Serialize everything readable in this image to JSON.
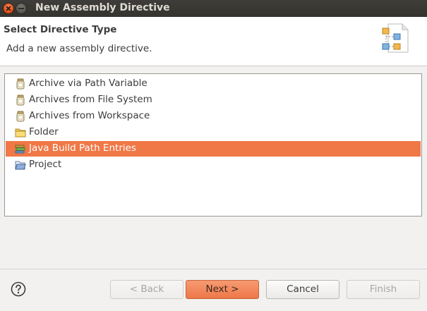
{
  "window": {
    "title": "New Assembly Directive"
  },
  "header": {
    "title": "Select Directive Type",
    "description": "Add a new assembly directive.",
    "icon": "wizard-banner-icon"
  },
  "list": {
    "items": [
      {
        "label": "Archive via Path Variable",
        "icon": "jar-icon",
        "selected": false
      },
      {
        "label": "Archives from File System",
        "icon": "jar-icon",
        "selected": false
      },
      {
        "label": "Archives from Workspace",
        "icon": "jar-icon",
        "selected": false
      },
      {
        "label": "Folder",
        "icon": "folder-icon",
        "selected": false
      },
      {
        "label": "Java Build Path Entries",
        "icon": "library-icon",
        "selected": true
      },
      {
        "label": "Project",
        "icon": "project-folder-icon",
        "selected": false
      }
    ]
  },
  "footer": {
    "back_label": "< Back",
    "next_label": "Next >",
    "cancel_label": "Cancel",
    "finish_label": "Finish"
  },
  "colors": {
    "selection": "#f07746",
    "primary_button": "#ee7748",
    "titlebar": "#3c3b37"
  }
}
